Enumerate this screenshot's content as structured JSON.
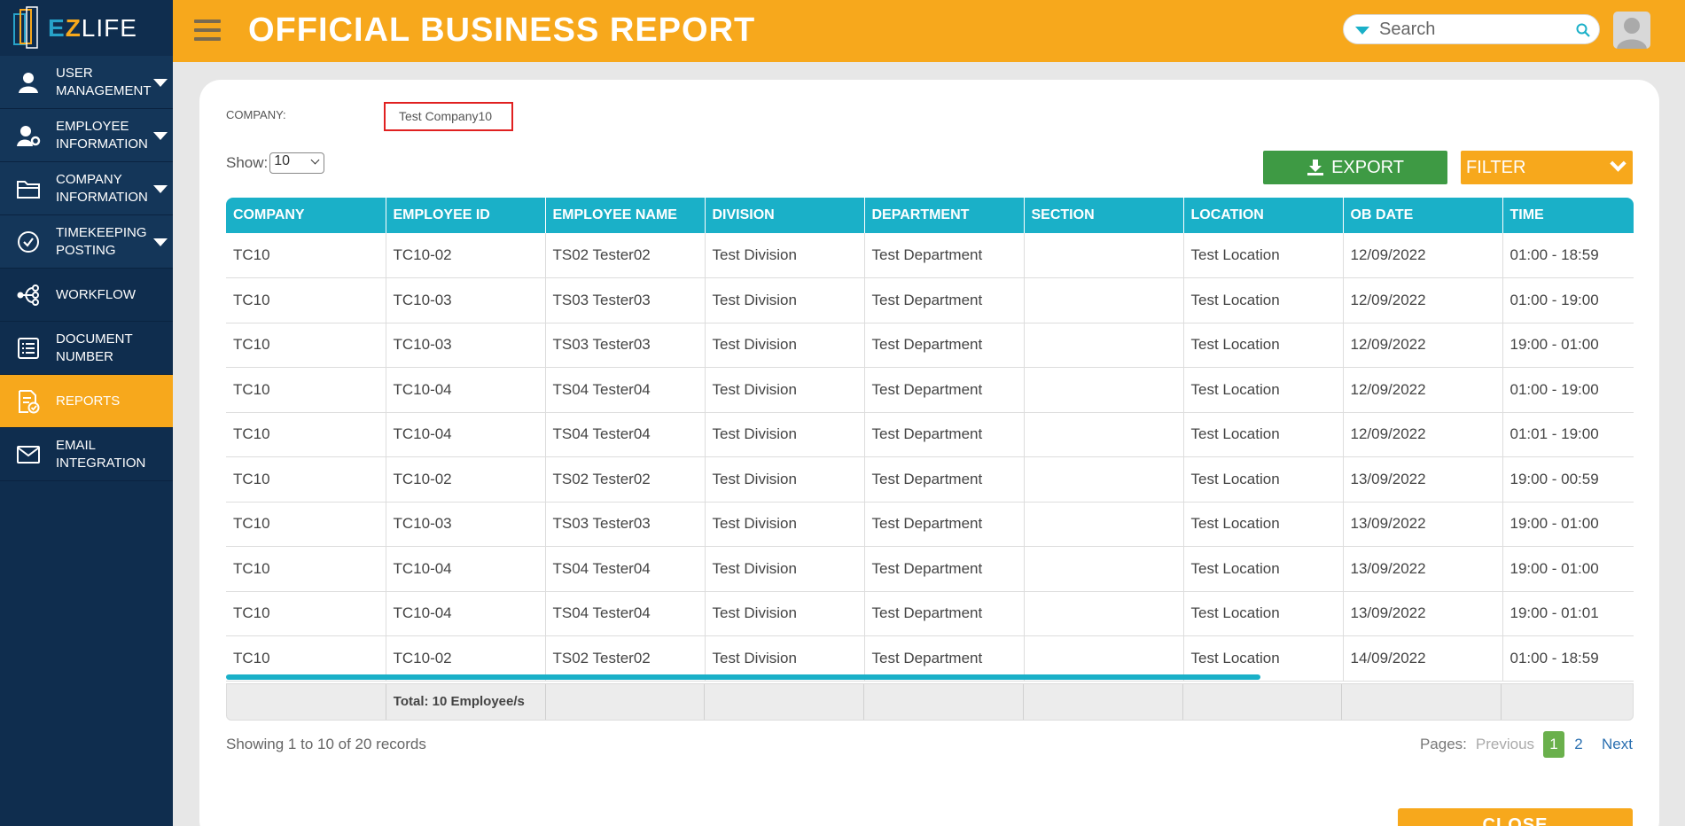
{
  "brand": {
    "e": "E",
    "z": "Z",
    "life": "LIFE"
  },
  "colors": {
    "sidebar": "#0f2d4e",
    "accent": "#f7a81c",
    "table_header": "#1ab0c8",
    "export": "#3e9a44"
  },
  "sidebar": {
    "items": [
      {
        "label": "USER MANAGEMENT",
        "icon": "user-icon",
        "caret": true
      },
      {
        "label": "EMPLOYEE INFORMATION",
        "icon": "employee-gear-icon",
        "caret": true
      },
      {
        "label": "COMPANY INFORMATION",
        "icon": "folder-icon",
        "caret": true
      },
      {
        "label": "TIMEKEEPING POSTING",
        "icon": "check-circle-icon",
        "caret": true
      },
      {
        "label": "WORKFLOW",
        "icon": "workflow-icon",
        "caret": false
      },
      {
        "label": "DOCUMENT NUMBER",
        "icon": "document-list-icon",
        "caret": false
      },
      {
        "label": "REPORTS",
        "icon": "report-icon",
        "caret": false,
        "active": true
      },
      {
        "label": "EMAIL INTEGRATION",
        "icon": "mail-icon",
        "caret": false
      }
    ]
  },
  "header": {
    "title": "OFFICIAL BUSINESS REPORT",
    "search_placeholder": "Search"
  },
  "filters": {
    "company_label": "COMPANY:",
    "company_value": "Test Company10",
    "show_label": "Show:",
    "show_value": "10"
  },
  "toolbar": {
    "export_label": "EXPORT",
    "filter_label": "FILTER"
  },
  "table": {
    "columns": [
      "COMPANY",
      "EMPLOYEE ID",
      "EMPLOYEE NAME",
      "DIVISION",
      "DEPARTMENT",
      "SECTION",
      "LOCATION",
      "OB DATE",
      "TIME"
    ],
    "rows": [
      [
        "TC10",
        "TC10-02",
        "TS02 Tester02",
        "Test Division",
        "Test Department",
        "",
        "Test Location",
        "12/09/2022",
        "01:00 - 18:59"
      ],
      [
        "TC10",
        "TC10-03",
        "TS03 Tester03",
        "Test Division",
        "Test Department",
        "",
        "Test Location",
        "12/09/2022",
        "01:00 - 19:00"
      ],
      [
        "TC10",
        "TC10-03",
        "TS03 Tester03",
        "Test Division",
        "Test Department",
        "",
        "Test Location",
        "12/09/2022",
        "19:00 - 01:00"
      ],
      [
        "TC10",
        "TC10-04",
        "TS04 Tester04",
        "Test Division",
        "Test Department",
        "",
        "Test Location",
        "12/09/2022",
        "01:00 - 19:00"
      ],
      [
        "TC10",
        "TC10-04",
        "TS04 Tester04",
        "Test Division",
        "Test Department",
        "",
        "Test Location",
        "12/09/2022",
        "01:01 - 19:00"
      ],
      [
        "TC10",
        "TC10-02",
        "TS02 Tester02",
        "Test Division",
        "Test Department",
        "",
        "Test Location",
        "13/09/2022",
        "19:00 - 00:59"
      ],
      [
        "TC10",
        "TC10-03",
        "TS03 Tester03",
        "Test Division",
        "Test Department",
        "",
        "Test Location",
        "13/09/2022",
        "19:00 - 01:00"
      ],
      [
        "TC10",
        "TC10-04",
        "TS04 Tester04",
        "Test Division",
        "Test Department",
        "",
        "Test Location",
        "13/09/2022",
        "19:00 - 01:00"
      ],
      [
        "TC10",
        "TC10-04",
        "TS04 Tester04",
        "Test Division",
        "Test Department",
        "",
        "Test Location",
        "13/09/2022",
        "19:00 - 01:01"
      ],
      [
        "TC10",
        "TC10-02",
        "TS02 Tester02",
        "Test Division",
        "Test Department",
        "",
        "Test Location",
        "14/09/2022",
        "01:00 - 18:59"
      ]
    ],
    "total_label": "Total: 10 Employee/s"
  },
  "footer": {
    "records_info": "Showing 1 to 10 of 20 records",
    "pages_label": "Pages:",
    "previous": "Previous",
    "pages": [
      "1",
      "2"
    ],
    "next": "Next",
    "close_label": "CLOSE"
  }
}
